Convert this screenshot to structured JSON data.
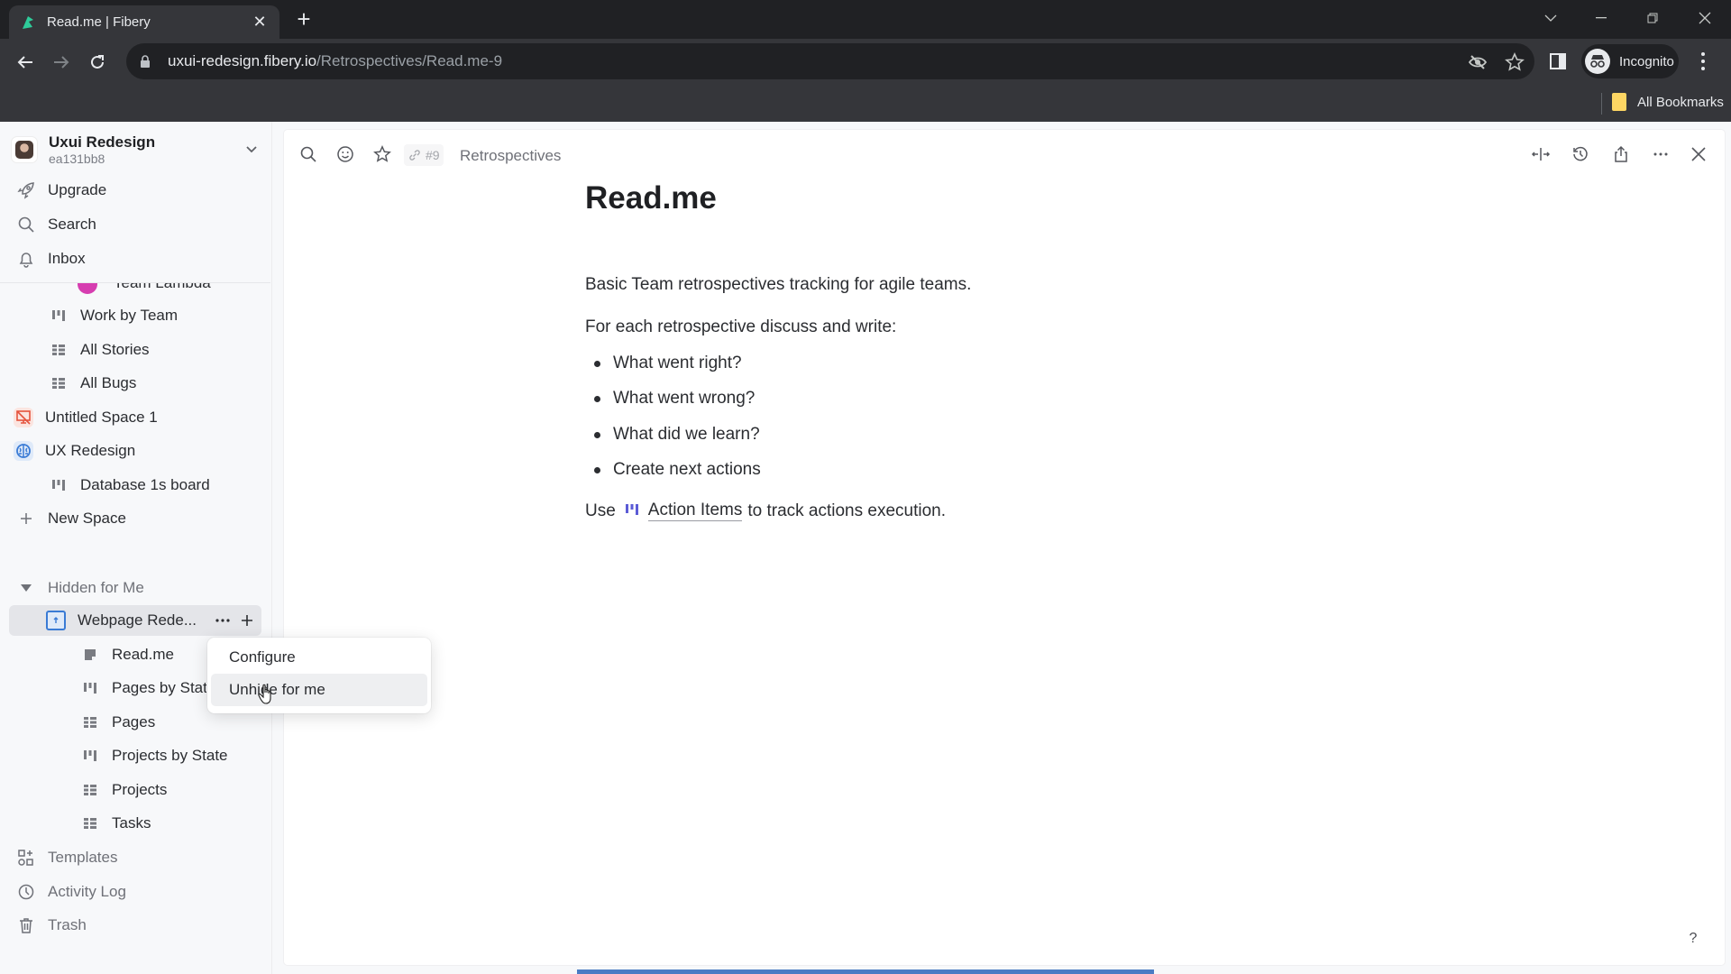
{
  "browser": {
    "tab_title": "Read.me | Fibery",
    "url_host": "uxui-redesign.fibery.io",
    "url_path": "/Retrospectives/Read.me-9",
    "profile_label": "Incognito",
    "bookmarks_label": "All Bookmarks"
  },
  "workspace": {
    "name": "Uxui Redesign",
    "id": "ea131bb8"
  },
  "sidebar": {
    "top_items": [
      {
        "label": "Upgrade",
        "icon": "rocket-icon"
      },
      {
        "label": "Search",
        "icon": "search-icon"
      },
      {
        "label": "Inbox",
        "icon": "bell-icon"
      }
    ],
    "partial_item": {
      "label": "Team Lambda",
      "color": "#d63db0"
    },
    "tree": [
      {
        "label": "Work by Team",
        "icon": "board-icon",
        "level": 2
      },
      {
        "label": "All Stories",
        "icon": "table-icon",
        "level": 2
      },
      {
        "label": "All Bugs",
        "icon": "table-icon",
        "level": 2
      },
      {
        "label": "Untitled Space 1",
        "icon": "space-icon",
        "level": 1,
        "color": "#e5533d"
      },
      {
        "label": "UX Redesign",
        "icon": "brain-icon",
        "level": 1,
        "color": "#3a7bd5"
      },
      {
        "label": "Database 1s board",
        "icon": "board-icon",
        "level": 2
      }
    ],
    "new_space_label": "New Space",
    "hidden_section_label": "Hidden for Me",
    "hidden_space": {
      "label": "Webpage Rede...",
      "color": "#3a7bd5"
    },
    "hidden_children": [
      {
        "label": "Read.me",
        "icon": "document-icon"
      },
      {
        "label": "Pages by State",
        "icon": "board-icon"
      },
      {
        "label": "Pages",
        "icon": "table-icon"
      },
      {
        "label": "Projects by State",
        "icon": "board-icon"
      },
      {
        "label": "Projects",
        "icon": "table-icon"
      },
      {
        "label": "Tasks",
        "icon": "table-icon"
      }
    ],
    "bottom_items": [
      {
        "label": "Templates",
        "icon": "templates-icon"
      },
      {
        "label": "Activity Log",
        "icon": "clock-icon"
      },
      {
        "label": "Trash",
        "icon": "trash-icon"
      }
    ]
  },
  "context_menu": {
    "items": [
      {
        "label": "Configure"
      },
      {
        "label": "Unhide for me"
      }
    ],
    "hovered_index": 1
  },
  "panel": {
    "entity_id": "#9",
    "breadcrumb": "Retrospectives",
    "title": "Read.me",
    "paragraph_1": "Basic Team retrospectives tracking for agile teams.",
    "paragraph_2": "For each retrospective discuss and write:",
    "bullets": [
      "What went right?",
      "What went wrong?",
      "What did we learn?",
      "Create next actions"
    ],
    "footer_prefix": "Use",
    "footer_link": "Action Items",
    "footer_suffix": "to track actions execution.",
    "help_label": "?"
  },
  "colors": {
    "accent": "#4a7cc4",
    "link_icon": "#5b5bd6"
  }
}
